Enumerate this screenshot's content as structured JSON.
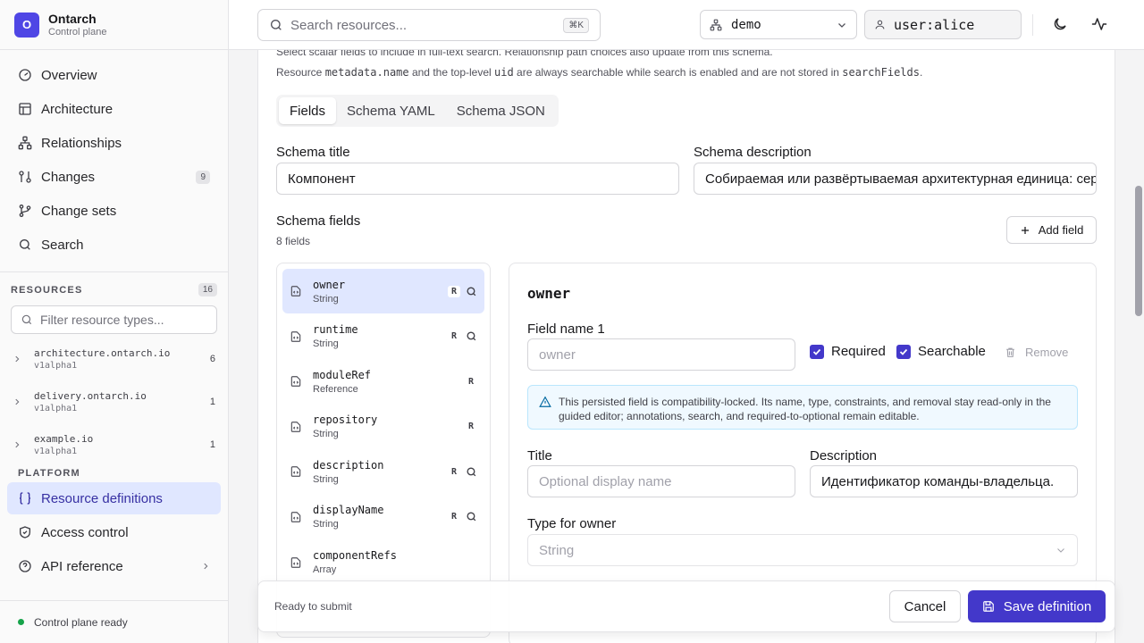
{
  "brand": {
    "initial": "O",
    "name": "Ontarch",
    "subtitle": "Control plane"
  },
  "nav": [
    {
      "label": "Overview",
      "icon": "gauge-icon"
    },
    {
      "label": "Architecture",
      "icon": "layout-icon"
    },
    {
      "label": "Relationships",
      "icon": "network-icon"
    },
    {
      "label": "Changes",
      "icon": "git-compare-icon",
      "badge": "9"
    },
    {
      "label": "Change sets",
      "icon": "git-branch-icon"
    },
    {
      "label": "Search",
      "icon": "search-icon"
    }
  ],
  "resources": {
    "title": "RESOURCES",
    "count": "16",
    "filter_placeholder": "Filter resource types...",
    "groups": [
      {
        "name": "architecture.ontarch.io",
        "version": "v1alpha1",
        "count": "6"
      },
      {
        "name": "delivery.ontarch.io",
        "version": "v1alpha1",
        "count": "1"
      },
      {
        "name": "example.io",
        "version": "v1alpha1",
        "count": "1"
      }
    ]
  },
  "platform": {
    "title": "PLATFORM",
    "items": [
      {
        "label": "Resource definitions",
        "icon": "braces-icon"
      },
      {
        "label": "Access control",
        "icon": "shield-icon"
      },
      {
        "label": "API reference",
        "icon": "help-circle-icon"
      }
    ]
  },
  "footer": {
    "status": "Control plane ready",
    "status_color": "#16a34a"
  },
  "topbar": {
    "search_placeholder": "Search resources...",
    "search_shortcut": "⌘K",
    "context": "demo",
    "user": "user:alice"
  },
  "hints": {
    "line1": "Select scalar fields to include in full-text search. Relationship path choices also update from this schema.",
    "line2_a": "Resource ",
    "line2_code1": "metadata.name",
    "line2_b": " and the top-level ",
    "line2_code2": "uid",
    "line2_c": " are always searchable while search is enabled and are not stored in ",
    "line2_code3": "searchFields",
    "line2_d": "."
  },
  "tabs": [
    "Fields",
    "Schema YAML",
    "Schema JSON"
  ],
  "schema": {
    "title_label": "Schema title",
    "title_value": "Компонент",
    "description_label": "Schema description",
    "description_value": "Собираемая или развёртываемая архитектурная единица: сер",
    "fields_label": "Schema fields",
    "fields_count": "8 fields",
    "add_field": "Add field"
  },
  "fields": [
    {
      "name": "owner",
      "type": "String",
      "required": "R",
      "searchable": true
    },
    {
      "name": "runtime",
      "type": "String",
      "required": "R",
      "searchable": true
    },
    {
      "name": "moduleRef",
      "type": "Reference",
      "required": "R",
      "searchable": false
    },
    {
      "name": "repository",
      "type": "String",
      "required": "R",
      "searchable": false
    },
    {
      "name": "description",
      "type": "String",
      "required": "R",
      "searchable": true
    },
    {
      "name": "displayName",
      "type": "String",
      "required": "R",
      "searchable": true
    },
    {
      "name": "componentRefs",
      "type": "Array",
      "required": "",
      "searchable": false
    }
  ],
  "detail": {
    "title": "owner",
    "field_name_label": "Field name 1",
    "field_name_value": "owner",
    "required_label": "Required",
    "searchable_label": "Searchable",
    "remove_label": "Remove",
    "notice": "This persisted field is compatibility-locked. Its name, type, constraints, and removal stay read-only in the guided editor; annotations, search, and required-to-optional remain editable.",
    "title_label": "Title",
    "title_placeholder": "Optional display name",
    "description_label": "Description",
    "description_value": "Идентификатор команды-владельца.",
    "type_label": "Type for owner",
    "type_value": "String"
  },
  "actionbar": {
    "status": "Ready to submit",
    "cancel": "Cancel",
    "save": "Save definition"
  },
  "colors": {
    "accent": "#4338ca",
    "active_bg": "#e0e7ff"
  }
}
